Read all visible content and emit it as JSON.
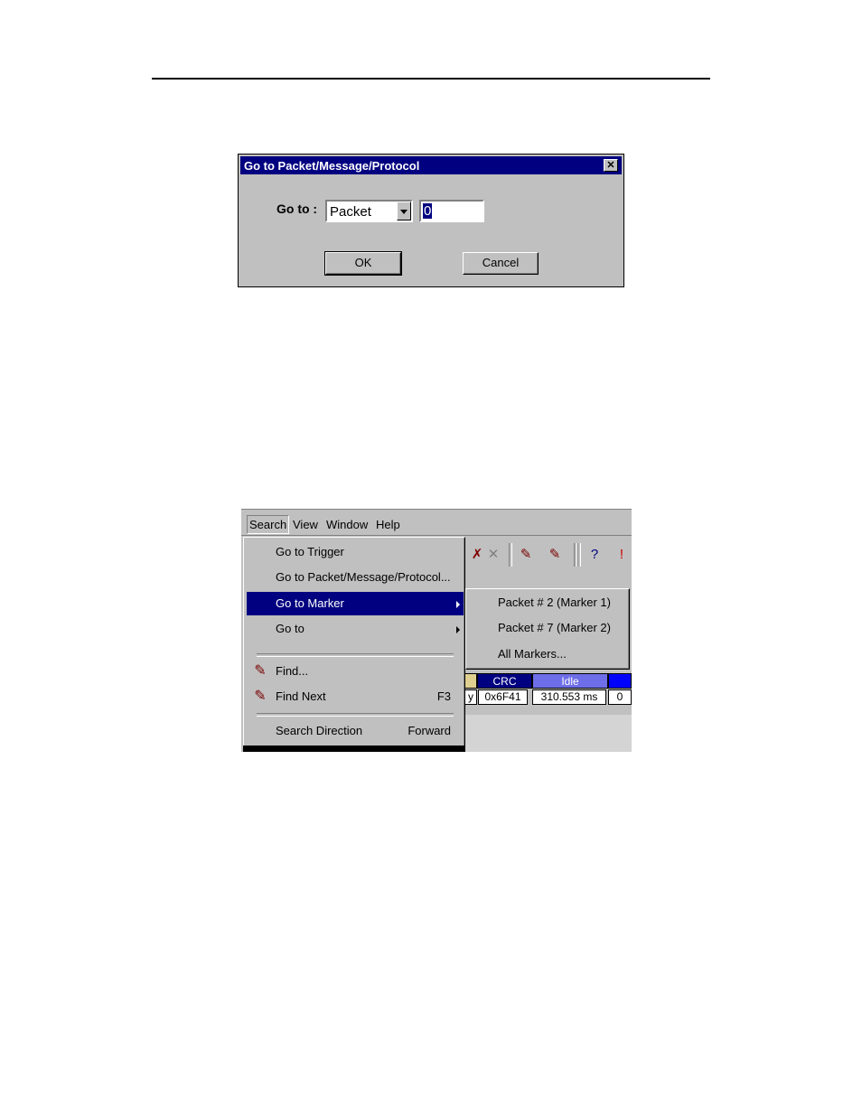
{
  "dialog": {
    "title": "Go to Packet/Message/Protocol",
    "close_glyph": "✕",
    "goto_label": "Go to :",
    "type_selected": "Packet",
    "number_value": "0",
    "ok_label": "OK",
    "cancel_label": "Cancel"
  },
  "menubar": {
    "items": [
      "Search",
      "View",
      "Window",
      "Help"
    ]
  },
  "search_menu": {
    "items": [
      {
        "label": "Go to Trigger"
      },
      {
        "label": "Go to Packet/Message/Protocol..."
      },
      {
        "label": "Go to Marker"
      },
      {
        "label": "Go to"
      },
      {
        "label": "Find..."
      },
      {
        "label": "Find Next",
        "accelerator": "F3"
      },
      {
        "label": "Search Direction",
        "accelerator": "Forward"
      }
    ]
  },
  "marker_submenu": {
    "items": [
      "Packet # 2 (Marker 1)",
      "Packet # 7 (Marker 2)",
      "All Markers..."
    ]
  },
  "packet_grid": {
    "headers": [
      "CRC",
      "Idle"
    ],
    "values": [
      "y",
      "0x6F41",
      "310.553 ms",
      "0"
    ]
  },
  "colors": {
    "title_bar": "#000080",
    "menu_highlight": "#000080",
    "crc_header": "#000080",
    "idle_header": "#6e6ee8",
    "extra_header": "#0000ff",
    "prev_header": "#e0d090"
  }
}
